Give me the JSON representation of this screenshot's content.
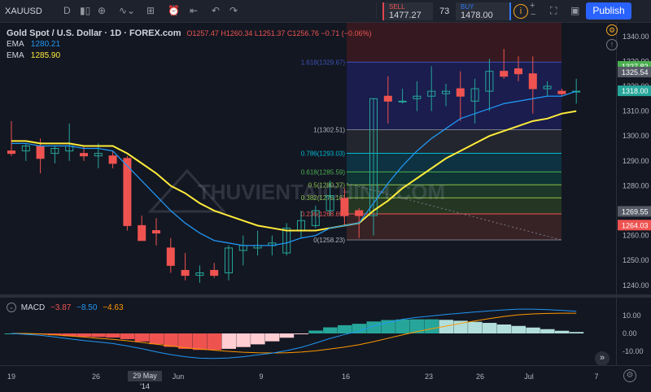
{
  "toolbar": {
    "symbol": "XAUUSD",
    "interval": "D",
    "sell_label": "SELL",
    "sell_price": "1477.27",
    "spread": "73",
    "buy_label": "BUY",
    "buy_price": "1478.00",
    "publish_label": "Publish"
  },
  "legend": {
    "title": "Gold Spot / U.S. Dollar · 1D · FOREX.com",
    "ohlc": "O1257.47 H1260.34 L1251.37 C1256.76 −0.71 (−0.06%)",
    "ema1_label": "EMA",
    "ema1_value": "1280.21",
    "ema2_label": "EMA",
    "ema2_value": "1285.90"
  },
  "macd": {
    "label": "MACD",
    "v1": "−3.87",
    "v2": "−8.50",
    "v3": "−4.63"
  },
  "watermark": "THUVIENTAICHINH.COM",
  "fib": [
    {
      "label": "1.618(1329.67)",
      "price": 1329.67
    },
    {
      "label": "1(1302.51)",
      "price": 1302.51
    },
    {
      "label": "0.786(1293.03)",
      "price": 1293.03
    },
    {
      "label": "0.618(1285.59)",
      "price": 1285.59
    },
    {
      "label": "0.5(1280.37)",
      "price": 1280.37
    },
    {
      "label": "0.382(1275.16)",
      "price": 1275.16
    },
    {
      "label": "0.236(1268.69)",
      "price": 1268.69
    },
    {
      "label": "0(1258.23)",
      "price": 1258.23
    }
  ],
  "price_axis": [
    "1340.00",
    "1330.00",
    "1320.00",
    "1310.00",
    "1300.00",
    "1290.00",
    "1280.00",
    "1270.00",
    "1260.00",
    "1250.00",
    "1240.00"
  ],
  "price_tags": [
    {
      "text": "1327.82",
      "color": "#4caf50"
    },
    {
      "text": "1325.54",
      "color": "#555a66"
    },
    {
      "text": "1318.00",
      "color": "#26a69a"
    },
    {
      "text": "1269.55",
      "color": "#555a66"
    },
    {
      "text": "1264.03",
      "color": "#ef5350"
    }
  ],
  "macd_axis": [
    "10.00",
    "0.00",
    "-10.00"
  ],
  "time_axis": [
    "19",
    "26",
    "29 May '14",
    "Jun",
    "9",
    "16",
    "23",
    "26",
    "Jul",
    "7"
  ],
  "colors": {
    "up": "#26a69a",
    "down": "#ef5350",
    "ema_fast": "#2196f3",
    "ema_slow": "#ffeb3b"
  },
  "chart_data": {
    "type": "candlestick",
    "ylim": [
      1235,
      1344
    ],
    "candles": [
      [
        1294,
        1306,
        1292,
        1293
      ],
      [
        1294,
        1297,
        1290,
        1296
      ],
      [
        1296,
        1299,
        1285,
        1291
      ],
      [
        1293,
        1296,
        1289,
        1295
      ],
      [
        1294,
        1305,
        1290,
        1296
      ],
      [
        1293,
        1296,
        1290,
        1292
      ],
      [
        1292,
        1297,
        1287,
        1293
      ],
      [
        1292,
        1294,
        1287,
        1289
      ],
      [
        1291,
        1292,
        1262,
        1264
      ],
      [
        1264,
        1268,
        1258,
        1258
      ],
      [
        1262,
        1267,
        1256,
        1261
      ],
      [
        1255,
        1259,
        1245,
        1248
      ],
      [
        1246,
        1253,
        1242,
        1244
      ],
      [
        1244,
        1248,
        1241,
        1245
      ],
      [
        1246,
        1249,
        1243,
        1244
      ],
      [
        1245,
        1256,
        1242,
        1255
      ],
      [
        1254,
        1260,
        1248,
        1256
      ],
      [
        1255,
        1262,
        1252,
        1256
      ],
      [
        1256,
        1260,
        1252,
        1257
      ],
      [
        1253,
        1265,
        1252,
        1263
      ],
      [
        1262,
        1270,
        1259,
        1266
      ],
      [
        1264,
        1272,
        1263,
        1270
      ],
      [
        1270,
        1282,
        1268,
        1276
      ],
      [
        1275,
        1279,
        1264,
        1268
      ],
      [
        1270,
        1271,
        1259,
        1268
      ],
      [
        1268,
        1315,
        1260,
        1315
      ],
      [
        1316,
        1324,
        1305,
        1314
      ],
      [
        1314,
        1319,
        1313,
        1314
      ],
      [
        1315,
        1322,
        1310,
        1316
      ],
      [
        1316,
        1328,
        1310,
        1318
      ],
      [
        1317,
        1321,
        1312,
        1318
      ],
      [
        1319,
        1326,
        1306,
        1316
      ],
      [
        1314,
        1323,
        1305,
        1319
      ],
      [
        1318,
        1331,
        1310,
        1326
      ],
      [
        1326,
        1335,
        1323,
        1324
      ],
      [
        1327,
        1332,
        1322,
        1325
      ],
      [
        1325,
        1332,
        1309,
        1319
      ],
      [
        1319,
        1322,
        1316,
        1320
      ],
      [
        1318,
        1319,
        1316,
        1317
      ],
      [
        1318,
        1323,
        1313,
        1318
      ]
    ],
    "ema_fast": [
      1297,
      1297,
      1296,
      1296,
      1296,
      1295,
      1295,
      1294,
      1288,
      1282,
      1276,
      1270,
      1265,
      1261,
      1258,
      1257,
      1256,
      1256,
      1256,
      1257,
      1259,
      1260,
      1263,
      1264,
      1265,
      1273,
      1281,
      1288,
      1294,
      1299,
      1303,
      1307,
      1309,
      1311,
      1313,
      1314,
      1315,
      1316,
      1316,
      1318
    ],
    "ema_slow": [
      1298,
      1298,
      1297,
      1297,
      1297,
      1296,
      1296,
      1296,
      1293,
      1289,
      1285,
      1280,
      1277,
      1273,
      1270,
      1268,
      1266,
      1264,
      1263,
      1262,
      1262,
      1262,
      1263,
      1264,
      1265,
      1270,
      1274,
      1279,
      1283,
      1287,
      1291,
      1294,
      1297,
      1300,
      1302,
      1304,
      1306,
      1307,
      1309,
      1310
    ],
    "macd_hist": [
      0,
      0,
      -0.5,
      -1,
      -1.5,
      -1.8,
      -2,
      -2.3,
      -3.2,
      -4.5,
      -6,
      -7.5,
      -8.6,
      -9.2,
      -9.2,
      -8.6,
      -7.6,
      -6.1,
      -4.4,
      -2.4,
      -0.2,
      1.6,
      3.4,
      4.6,
      5.4,
      6.7,
      7.5,
      7.8,
      7.9,
      7.9,
      7.6,
      7.1,
      6.5,
      5.9,
      5,
      4.2,
      3.3,
      2.4,
      1.5,
      0.8
    ],
    "macd_line": [
      0,
      -0.5,
      -1,
      -2,
      -3,
      -4,
      -4.8,
      -5.6,
      -7,
      -8.5,
      -10.3,
      -11.8,
      -13,
      -13.8,
      -14,
      -13.7,
      -13,
      -12,
      -11,
      -9.6,
      -7.8,
      -5.4,
      -2.8,
      -0.6,
      1.3,
      4.2,
      6.1,
      7.9,
      9,
      9.8,
      10.6,
      11.3,
      12,
      12.6,
      13.1,
      13.6,
      13.6,
      13.3,
      12.9,
      12.4
    ],
    "signal_line": [
      0,
      0,
      -0.3,
      -0.8,
      -1.4,
      -2,
      -2.7,
      -3.3,
      -4.1,
      -5,
      -6,
      -7,
      -8,
      -8.7,
      -9.4,
      -10,
      -10.5,
      -10.8,
      -10.9,
      -10.8,
      -10.4,
      -9.7,
      -8.7,
      -7.6,
      -6.3,
      -4.6,
      -2.7,
      -0.8,
      1,
      2.6,
      4.1,
      5.6,
      7,
      8.3,
      9.5,
      10.4,
      10.9,
      11.2,
      11.3,
      11.3
    ]
  }
}
